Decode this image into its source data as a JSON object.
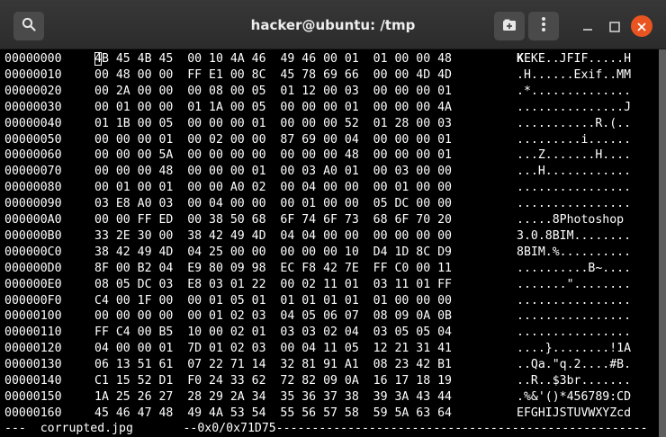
{
  "window": {
    "title": "hacker@ubuntu: /tmp"
  },
  "colors": {
    "titlebar": "#2c2c2c",
    "terminal_bg": "#000000",
    "terminal_fg": "#ffffff",
    "close_button": "#e95420"
  },
  "icons": {
    "search": "search-icon",
    "new_tab": "new-tab-icon",
    "menu": "kebab-menu-icon",
    "minimize": "minimize-icon",
    "maximize": "maximize-icon",
    "close": "close-icon"
  },
  "hexdump": {
    "rows": [
      {
        "addr": "00000000",
        "hex": "4B 45 4B 45  00 10 4A 46  49 46 00 01  01 00 00 48",
        "ascii": "KEKE..JFIF.....H"
      },
      {
        "addr": "00000010",
        "hex": "00 48 00 00  FF E1 00 8C  45 78 69 66  00 00 4D 4D",
        "ascii": ".H......Exif..MM"
      },
      {
        "addr": "00000020",
        "hex": "00 2A 00 00  00 08 00 05  01 12 00 03  00 00 00 01",
        "ascii": ".*.............."
      },
      {
        "addr": "00000030",
        "hex": "00 01 00 00  01 1A 00 05  00 00 00 01  00 00 00 4A",
        "ascii": "...............J"
      },
      {
        "addr": "00000040",
        "hex": "01 1B 00 05  00 00 00 01  00 00 00 52  01 28 00 03",
        "ascii": "...........R.(.."
      },
      {
        "addr": "00000050",
        "hex": "00 00 00 01  00 02 00 00  87 69 00 04  00 00 00 01",
        "ascii": ".........i......"
      },
      {
        "addr": "00000060",
        "hex": "00 00 00 5A  00 00 00 00  00 00 00 48  00 00 00 01",
        "ascii": "...Z.......H...."
      },
      {
        "addr": "00000070",
        "hex": "00 00 00 48  00 00 00 01  00 03 A0 01  00 03 00 00",
        "ascii": "...H............"
      },
      {
        "addr": "00000080",
        "hex": "00 01 00 01  00 00 A0 02  00 04 00 00  00 01 00 00",
        "ascii": "................"
      },
      {
        "addr": "00000090",
        "hex": "03 E8 A0 03  00 04 00 00  00 01 00 00  05 DC 00 00",
        "ascii": "................"
      },
      {
        "addr": "000000A0",
        "hex": "00 00 FF ED  00 38 50 68  6F 74 6F 73  68 6F 70 20",
        "ascii": ".....8Photoshop "
      },
      {
        "addr": "000000B0",
        "hex": "33 2E 30 00  38 42 49 4D  04 04 00 00  00 00 00 00",
        "ascii": "3.0.8BIM........"
      },
      {
        "addr": "000000C0",
        "hex": "38 42 49 4D  04 25 00 00  00 00 00 10  D4 1D 8C D9",
        "ascii": "8BIM.%.........."
      },
      {
        "addr": "000000D0",
        "hex": "8F 00 B2 04  E9 80 09 98  EC F8 42 7E  FF C0 00 11",
        "ascii": "..........B~...."
      },
      {
        "addr": "000000E0",
        "hex": "08 05 DC 03  E8 03 01 22  00 02 11 01  03 11 01 FF",
        "ascii": ".......\"........"
      },
      {
        "addr": "000000F0",
        "hex": "C4 00 1F 00  00 01 05 01  01 01 01 01  01 00 00 00",
        "ascii": "................"
      },
      {
        "addr": "00000100",
        "hex": "00 00 00 00  00 01 02 03  04 05 06 07  08 09 0A 0B",
        "ascii": "................"
      },
      {
        "addr": "00000110",
        "hex": "FF C4 00 B5  10 00 02 01  03 03 02 04  03 05 05 04",
        "ascii": "................"
      },
      {
        "addr": "00000120",
        "hex": "04 00 00 01  7D 01 02 03  00 04 11 05  12 21 31 41",
        "ascii": "....}........!1A"
      },
      {
        "addr": "00000130",
        "hex": "06 13 51 61  07 22 71 14  32 81 91 A1  08 23 42 B1",
        "ascii": "..Qa.\"q.2....#B."
      },
      {
        "addr": "00000140",
        "hex": "C1 15 52 D1  F0 24 33 62  72 82 09 0A  16 17 18 19",
        "ascii": "..R..$3br......."
      },
      {
        "addr": "00000150",
        "hex": "1A 25 26 27  28 29 2A 34  35 36 37 38  39 3A 43 44",
        "ascii": ".%&'()*456789:CD"
      },
      {
        "addr": "00000160",
        "hex": "45 46 47 48  49 4A 53 54  55 56 57 58  59 5A 63 64",
        "ascii": "EFGHIJSTUVWXYZcd"
      }
    ],
    "status_line": "---  corrupted.jpg       --0x0/0x71D75----------------------------------------------------"
  }
}
